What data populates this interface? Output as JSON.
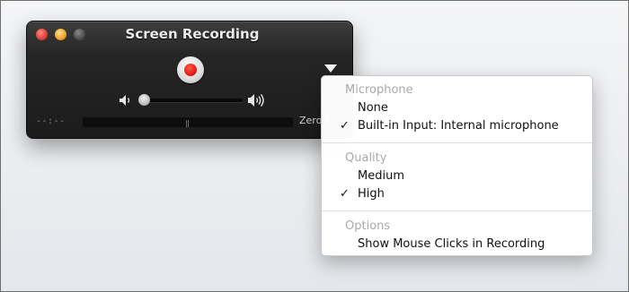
{
  "window": {
    "title": "Screen Recording",
    "time_elapsed": "--:--",
    "file_size": "Zero KB",
    "volume_level": 0.05
  },
  "menu": {
    "sections": [
      {
        "header": "Microphone",
        "items": [
          {
            "label": "None",
            "checked": false
          },
          {
            "label": "Built-in Input: Internal microphone",
            "checked": true
          }
        ]
      },
      {
        "header": "Quality",
        "items": [
          {
            "label": "Medium",
            "checked": false
          },
          {
            "label": "High",
            "checked": true
          }
        ]
      },
      {
        "header": "Options",
        "items": [
          {
            "label": "Show Mouse Clicks in Recording",
            "checked": false
          }
        ]
      }
    ],
    "check_glyph": "✓"
  },
  "colors": {
    "record_red": "#e51e15",
    "hud_dark": "#1b1b1b",
    "menu_header_gray": "#a9a9a9"
  },
  "icons": {
    "record": "record-icon",
    "volume_low": "speaker-low-icon",
    "volume_high": "speaker-high-icon",
    "menu_toggle": "triangle-down-icon"
  }
}
